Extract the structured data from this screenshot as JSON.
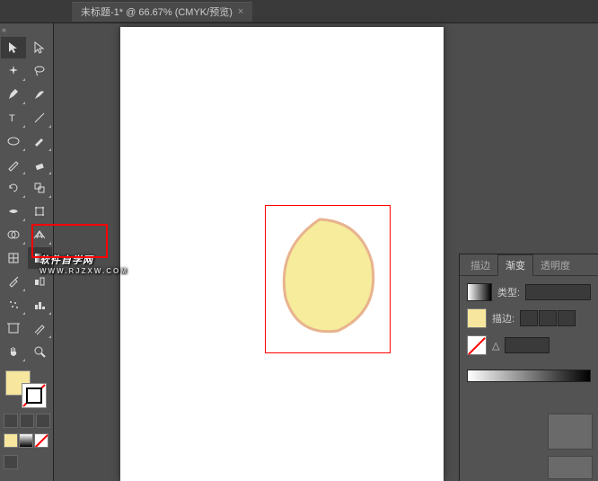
{
  "tab": {
    "title": "未标题-1* @ 66.67% (CMYK/预览)",
    "close": "×"
  },
  "watermark": {
    "main": "软件自学网",
    "sub": "WWW.RJZXW.COM"
  },
  "panel": {
    "tabs": {
      "stroke": "描边",
      "gradient": "渐变",
      "opacity": "透明度"
    },
    "type_label": "类型:",
    "stroke_label": "描边:",
    "delta": "△"
  },
  "colors": {
    "fill": "#f7e79e",
    "swatch1": "#f7e79e",
    "swatch2": "#555555",
    "swatch3": "#ffffff"
  }
}
